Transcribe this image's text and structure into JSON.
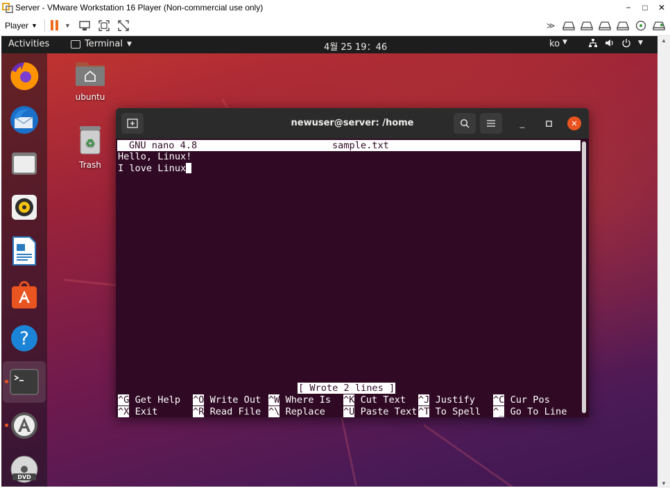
{
  "window": {
    "title": "Server - VMware Workstation 16 Player (Non-commercial use only)",
    "controls": [
      "−",
      "□",
      "✕"
    ]
  },
  "toolbar": {
    "player_label": "Player",
    "right_icons": [
      "forward-icon",
      "hdd-icon",
      "hdd-icon",
      "hdd-icon",
      "network-icon",
      "cd-icon",
      "settings-icon"
    ]
  },
  "ubuntu": {
    "activities": "Activities",
    "app_menu": "Terminal",
    "clock": "4월 25  19：46",
    "language": "ko",
    "dock": [
      "firefox",
      "thunderbird",
      "files",
      "rhythmbox",
      "libreoffice-writer",
      "ubuntu-software",
      "help",
      "terminal",
      "software-updater",
      "dvd"
    ],
    "desktop_icons": [
      {
        "label": "ubuntu"
      },
      {
        "label": "Trash"
      }
    ]
  },
  "terminal": {
    "title": "newuser@server: /home",
    "nano": {
      "version": "GNU nano 4.8",
      "filename": "sample.txt",
      "lines": [
        "Hello, Linux!",
        "I love Linux"
      ],
      "status": "[ Wrote 2 lines ]",
      "shortcuts": [
        {
          "key": "^G",
          "label": "Get Help"
        },
        {
          "key": "^O",
          "label": "Write Out"
        },
        {
          "key": "^W",
          "label": "Where Is"
        },
        {
          "key": "^K",
          "label": "Cut Text"
        },
        {
          "key": "^J",
          "label": "Justify"
        },
        {
          "key": "^C",
          "label": "Cur Pos"
        },
        {
          "key": "^X",
          "label": "Exit"
        },
        {
          "key": "^R",
          "label": "Read File"
        },
        {
          "key": "^\\",
          "label": "Replace"
        },
        {
          "key": "^U",
          "label": "Paste Text"
        },
        {
          "key": "^T",
          "label": "To Spell"
        },
        {
          "key": "^_",
          "label": "Go To Line"
        }
      ]
    }
  },
  "colors": {
    "ubuntu_orange": "#e95420",
    "terminal_bg": "#300a24",
    "topbar": "#1d1d1d",
    "vmware_pause": "#ee6c1b"
  }
}
